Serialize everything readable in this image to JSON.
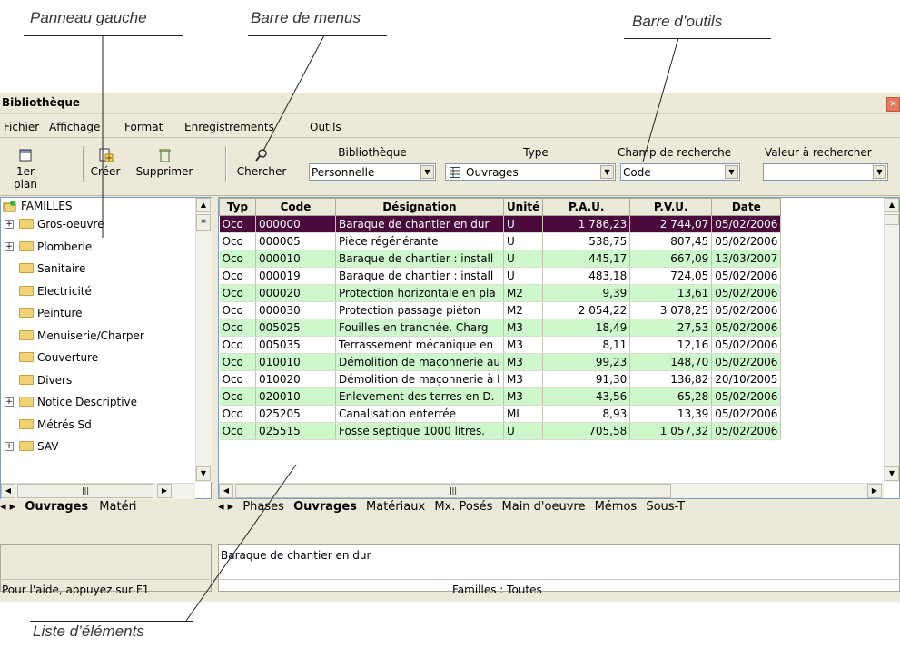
{
  "callouts": {
    "left_panel": "Panneau gauche",
    "menu_bar": "Barre de menus",
    "toolbar": "Barre d’outils",
    "item_list": "Liste d’éléments"
  },
  "window": {
    "title": "Bibliothèque",
    "close": "×"
  },
  "menu": [
    "Fichier",
    "Affichage",
    "Format",
    "Enregistrements",
    "Outils"
  ],
  "toolbar": {
    "first_plan": "1er plan",
    "create": "Créer",
    "delete": "Supprimer",
    "search": "Chercher",
    "library_label": "Bibliothèque",
    "library_value": "Personnelle",
    "type_label": "Type",
    "type_value": "Ouvrages",
    "field_label": "Champ de recherche",
    "field_value": "Code",
    "value_label": "Valeur à rechercher",
    "value_value": ""
  },
  "tree": {
    "root": "FAMILLES",
    "items": [
      {
        "label": "Gros-oeuvre",
        "expandable": true
      },
      {
        "label": "Plomberie",
        "expandable": true
      },
      {
        "label": "Sanitaire",
        "expandable": false
      },
      {
        "label": "Electricité",
        "expandable": false
      },
      {
        "label": "Peinture",
        "expandable": false
      },
      {
        "label": "Menuiserie/Charper",
        "expandable": false
      },
      {
        "label": "Couverture",
        "expandable": false
      },
      {
        "label": "Divers",
        "expandable": false
      },
      {
        "label": "Notice Descriptive",
        "expandable": true
      },
      {
        "label": "Métrés Sd",
        "expandable": false
      },
      {
        "label": "SAV",
        "expandable": true
      }
    ]
  },
  "left_tabs": [
    "Ouvrages",
    "Matéri"
  ],
  "grid": {
    "columns": [
      "Typ",
      "Code",
      "Désignation",
      "Unité",
      "P.A.U.",
      "P.V.U.",
      "Date"
    ],
    "rows": [
      [
        "Oco",
        "000000",
        "Baraque de chantier en dur",
        "U",
        "1 786,23",
        "2 744,07",
        "05/02/2006"
      ],
      [
        "Oco",
        "000005",
        "Pièce régénérante",
        "U",
        "538,75",
        "807,45",
        "05/02/2006"
      ],
      [
        "Oco",
        "000010",
        "Baraque de chantier : install",
        "U",
        "445,17",
        "667,09",
        "13/03/2007"
      ],
      [
        "Oco",
        "000019",
        "Baraque de chantier : install",
        "U",
        "483,18",
        "724,05",
        "05/02/2006"
      ],
      [
        "Oco",
        "000020",
        "Protection horizontale en pla",
        "M2",
        "9,39",
        "13,61",
        "05/02/2006"
      ],
      [
        "Oco",
        "000030",
        "Protection passage piéton",
        "M2",
        "2 054,22",
        "3 078,25",
        "05/02/2006"
      ],
      [
        "Oco",
        "005025",
        "Fouilles en tranchée. Charg",
        "M3",
        "18,49",
        "27,53",
        "05/02/2006"
      ],
      [
        "Oco",
        "005035",
        "Terrassement mécanique en",
        "M3",
        "8,11",
        "12,16",
        "05/02/2006"
      ],
      [
        "Oco",
        "010010",
        "Démolition de maçonnerie au",
        "M3",
        "99,23",
        "148,70",
        "05/02/2006"
      ],
      [
        "Oco",
        "010020",
        "Démolition de maçonnerie à l",
        "M3",
        "91,30",
        "136,82",
        "20/10/2005"
      ],
      [
        "Oco",
        "020010",
        "Enlevement des terres en D.",
        "M3",
        "43,56",
        "65,28",
        "05/02/2006"
      ],
      [
        "Oco",
        "025205",
        "Canalisation enterrée",
        "ML",
        "8,93",
        "13,39",
        "05/02/2006"
      ],
      [
        "Oco",
        "025515",
        "Fosse septique 1000 litres.",
        "U",
        "705,58",
        "1 057,32",
        "05/02/2006"
      ]
    ]
  },
  "grid_tabs": [
    "Phases",
    "Ouvrages",
    "Matériaux",
    "Mx. Posés",
    "Main d'oeuvre",
    "Mémos",
    "Sous-T"
  ],
  "notes_text": "Baraque de chantier en dur",
  "status": {
    "help": "Pour l'aide, appuyez sur F1",
    "families": "Familles : Toutes"
  }
}
